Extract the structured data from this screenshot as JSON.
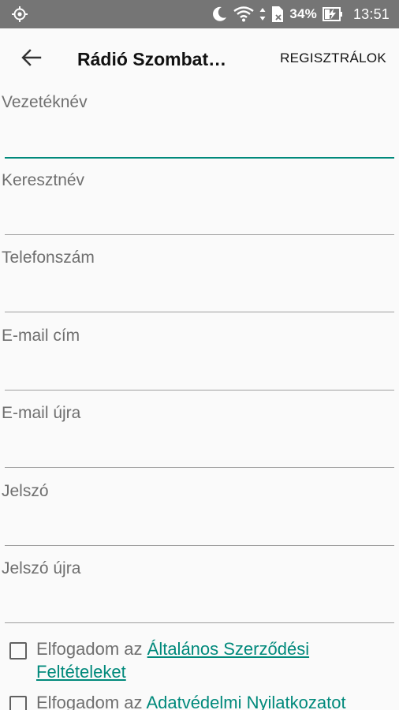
{
  "status_bar": {
    "battery": "34%",
    "time": "13:51",
    "icons": [
      "location-target-icon",
      "moon-icon",
      "wifi-icon",
      "data-arrows-icon",
      "sim-icon",
      "battery-charging-icon"
    ]
  },
  "app_bar": {
    "title": "Rádió Szombat…",
    "action": "REGISZTRÁLOK"
  },
  "form": {
    "fields": [
      {
        "label": "Vezetéknév",
        "value": ""
      },
      {
        "label": "Keresztnév",
        "value": ""
      },
      {
        "label": "Telefonszám",
        "value": ""
      },
      {
        "label": "E-mail cím",
        "value": ""
      },
      {
        "label": "E-mail újra",
        "value": ""
      },
      {
        "label": "Jelszó",
        "value": ""
      },
      {
        "label": "Jelszó újra",
        "value": ""
      }
    ]
  },
  "consents": [
    {
      "prefix": "Elfogadom az ",
      "link": "Általános Szerződési Feltételeket",
      "checked": false
    },
    {
      "prefix": "Elfogadom az ",
      "link": "Adatvédelmi Nyilatkozatot",
      "checked": false
    }
  ],
  "colors": {
    "accent": "#00897b",
    "status_bar": "#757575",
    "background": "#fafafa"
  }
}
